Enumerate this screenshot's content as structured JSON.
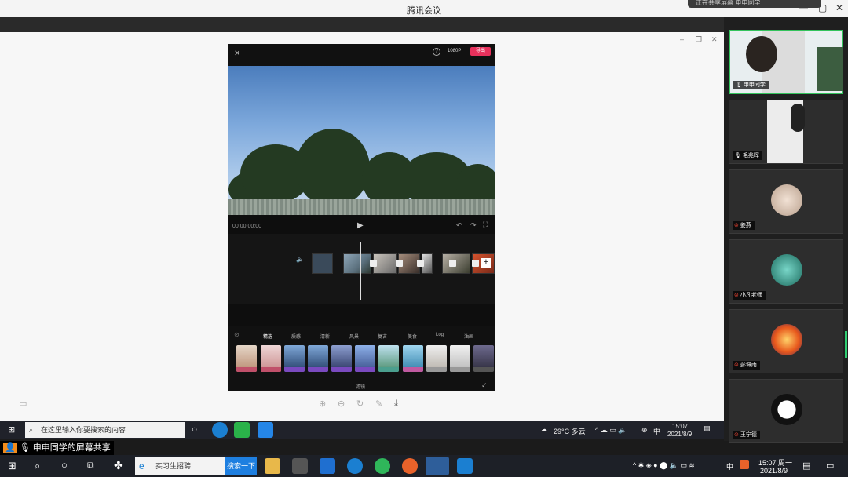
{
  "window": {
    "title": "腾讯会议",
    "notification": "正在共享屏幕 申申同学"
  },
  "app_preview": {
    "resolution": "1080P",
    "export_label": "导出",
    "timecode": "00:00:00:00",
    "filter_tabs": [
      "精选",
      "质感",
      "清新",
      "风景",
      "复古",
      "美食",
      "Log",
      "油画"
    ],
    "filter_button_label": "滤镜"
  },
  "taskbar_inner": {
    "search_placeholder": "在这里输入你要搜索的内容",
    "weather": "29°C 多云",
    "ime": "中",
    "time": "15:07",
    "date": "2021/8/9"
  },
  "participants": [
    {
      "name": "申申同学"
    },
    {
      "name": "毛兆晖"
    },
    {
      "name": "姜燕"
    },
    {
      "name": "小凡老师"
    },
    {
      "name": "彭珮雨"
    },
    {
      "name": "王宁德"
    }
  ],
  "share_label": "申申同学的屏幕共享",
  "taskbar_outer": {
    "search_placeholder": "实习生招聘",
    "search_button": "搜索一下",
    "ime": "中",
    "time": "15:07 周一",
    "date": "2021/8/9"
  },
  "colors": {
    "accent_pink": "#e8315c",
    "active_speaker": "#33c35c",
    "search_blue": "#1e7fe0"
  }
}
